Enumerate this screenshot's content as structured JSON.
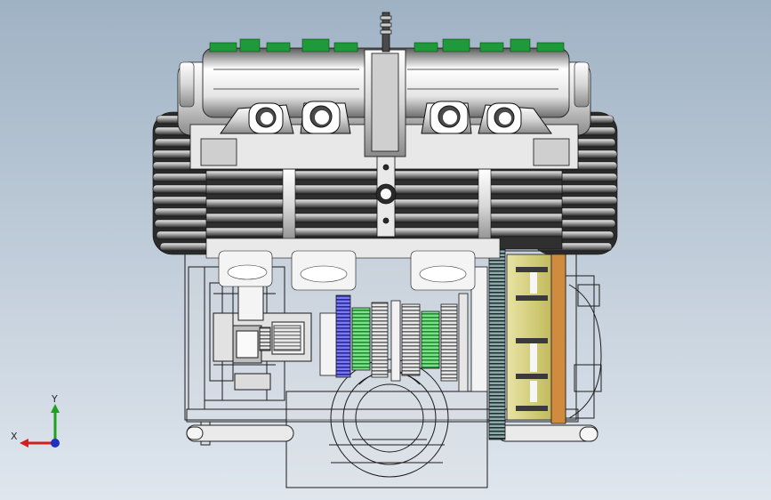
{
  "viewport": {
    "colors": {
      "bg_top": "#9fb2c4",
      "bg_bottom": "#dfe6ee",
      "green_part": "#1f9a3a",
      "gear_blue": "#4a4ad8",
      "gear_green": "#35c24a",
      "clutch_yellow": "#c9c46a",
      "clutch_orange": "#d08b3e"
    }
  },
  "triad": {
    "x_label": "X",
    "y_label": "Y",
    "x_color": "#d02020",
    "y_color": "#20a020",
    "z_color": "#2030c0"
  }
}
